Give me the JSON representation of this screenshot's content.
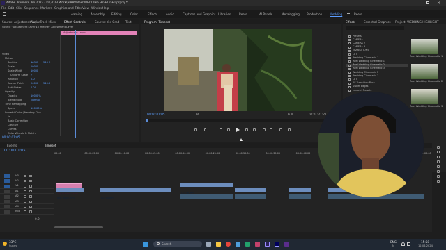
{
  "app": {
    "title": "Adobe Premiere Pro 2022 - D:\\2023 Work\\NIRAV\\Reel\\WEDDING HIGHLIGHT.prproj *"
  },
  "menu": [
    "File",
    "Edit",
    "Clip",
    "Sequence",
    "Markers",
    "Graphics and Titles",
    "View",
    "Window",
    "Help"
  ],
  "workspaces": {
    "items": [
      "Learning",
      "Assembly",
      "Editing",
      "Color",
      "Effects",
      "Audio",
      "Captions and Graphics",
      "Libraries",
      "Reels",
      "AI Panels",
      "Metalogging",
      "Production",
      "Wedding",
      "Reels"
    ],
    "active_index": 12
  },
  "source_panel": {
    "tabs": [
      "Source: Adjustment Layer",
      "Audio Track Mixer",
      "Effect Controls",
      "Source: Yes Grad",
      "Text"
    ],
    "clip_label": "Source · Adjustment Layer  ▸  Timeline · Adjustment Layer",
    "rows": [
      {
        "label": "Video"
      },
      {
        "label": "Motion",
        "ind": 1
      },
      {
        "label": "Position",
        "ind": 2,
        "v1": "960.0",
        "v2": "540.0"
      },
      {
        "label": "Scale",
        "ind": 2,
        "v1": "100.0"
      },
      {
        "label": "Scale Width",
        "ind": 2,
        "v1": "100.0"
      },
      {
        "label": "Uniform Scale",
        "ind": 3,
        "v1": "✓"
      },
      {
        "label": "Rotation",
        "ind": 2,
        "v1": "0.0"
      },
      {
        "label": "Anchor Point",
        "ind": 2,
        "v1": "960.0",
        "v2": "540.0"
      },
      {
        "label": "Anti-flicker",
        "ind": 2,
        "v1": "0.00"
      },
      {
        "label": "Opacity",
        "ind": 1
      },
      {
        "label": "Opacity",
        "ind": 2,
        "v1": "100.0 %"
      },
      {
        "label": "Blend Mode",
        "ind": 2,
        "v1": "Normal"
      },
      {
        "label": "Time Remapping",
        "ind": 1
      },
      {
        "label": "Speed",
        "ind": 2,
        "v1": "100.00%"
      },
      {
        "label": "Lumetri Color (Wedding Cine...",
        "ind": 1
      },
      {
        "label": "fx",
        "ind": 2
      },
      {
        "label": "Basic Correction",
        "ind": 2
      },
      {
        "label": "Creative",
        "ind": 2
      },
      {
        "label": "Curves",
        "ind": 2
      },
      {
        "label": "Color Wheels & Match",
        "ind": 2
      }
    ],
    "fx_clip": "Adjustment Layer",
    "timecode": "00:00:01:05"
  },
  "program": {
    "tab": "Program: Timeset",
    "timecode": "00:00:01:05",
    "fit": "Fit",
    "quality": "Full",
    "duration": "00:01:21:21"
  },
  "effects": {
    "tabs": [
      "Effects",
      "Essential Graphics",
      "Project: WEDDING HIGHLIGHT"
    ],
    "items": [
      "Presets",
      "CAMERA",
      "CAMERA 2",
      "CAMERA 3",
      "TRANSITIONS",
      "LUT",
      "Wedding Cinematic 1",
      "Reel Wedding Cinematic 1",
      "Reel Wedding Cinematic 2",
      "Reel Wedding Cinematic 3",
      "Wedding Cinematic 2",
      "Wedding Cinematic 3",
      "LUT",
      "AE Transition Pack",
      "Sweet Edges",
      "Lumetri Presets"
    ],
    "selected": 8,
    "thumbs": [
      {
        "label": "Reel Wedding Cinematic 1"
      },
      {
        "label": "Reel Wedding Cinematic 2"
      },
      {
        "label": "Reel Wedding Cinematic 3"
      }
    ]
  },
  "timeline": {
    "tabs": [
      "Events",
      "Timeset"
    ],
    "timecode": "00:00:01:05",
    "ruler": [
      "00:00",
      "00:00:05:00",
      "00:00:10:00",
      "00:00:15:00",
      "00:00:20:00",
      "00:00:25:00",
      "00:00:30:00",
      "00:00:35:00",
      "00:00:40:00",
      "00:00:45:00",
      "00:00:50:00",
      "00:00:55:00",
      "00:01:00:00"
    ],
    "tracks": [
      "V3",
      "V2",
      "V1",
      "A1",
      "A2",
      "A3",
      "A4",
      "Mix"
    ],
    "clips": {
      "adjustment": "Adjustment Layer",
      "v1a": "IMG_9802.MP4",
      "v1b": "C0714.MP4",
      "v1c": "C0736.MP4",
      "v1d": "C0735.MP4",
      "v1e": "C0747.MP4",
      "v1f": "C0752.MP4"
    },
    "mix_value": "0.0"
  },
  "taskbar": {
    "weather_temp": "33°C",
    "weather_desc": "Sunny",
    "search": "Search",
    "lang": "ENG",
    "lang2": "IN",
    "time": "15:58",
    "date": "12-06-2024"
  }
}
